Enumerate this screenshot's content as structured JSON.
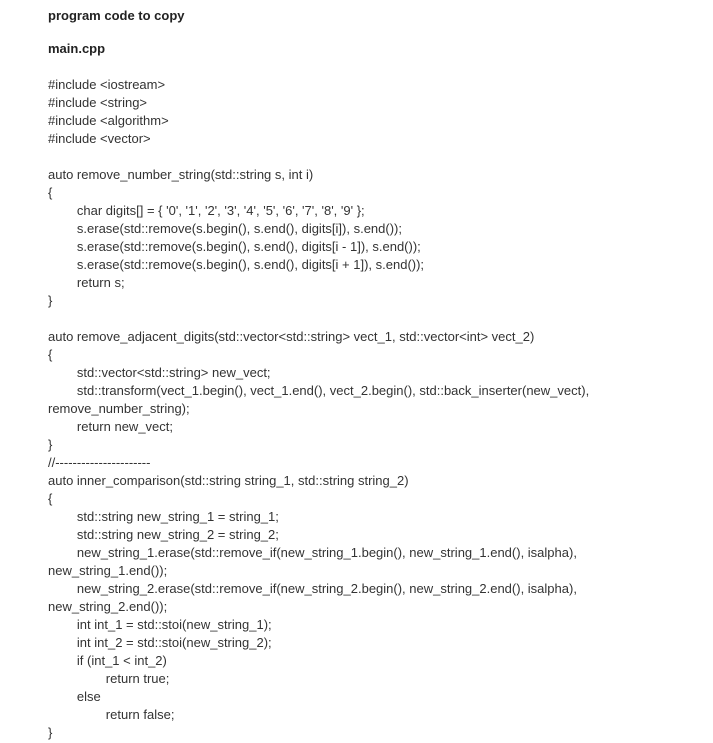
{
  "heading": "program code to copy",
  "filename": "main.cpp",
  "code_lines": [
    "#include <iostream>",
    "#include <string>",
    "#include <algorithm>",
    "#include <vector>",
    "",
    "auto remove_number_string(std::string s, int i)",
    "{",
    "        char digits[] = { '0', '1', '2', '3', '4', '5', '6', '7', '8', '9' };",
    "        s.erase(std::remove(s.begin(), s.end(), digits[i]), s.end());",
    "        s.erase(std::remove(s.begin(), s.end(), digits[i - 1]), s.end());",
    "        s.erase(std::remove(s.begin(), s.end(), digits[i + 1]), s.end());",
    "        return s;",
    "}",
    "",
    "auto remove_adjacent_digits(std::vector<std::string> vect_1, std::vector<int> vect_2)",
    "{",
    "        std::vector<std::string> new_vect;",
    "        std::transform(vect_1.begin(), vect_1.end(), vect_2.begin(), std::back_inserter(new_vect),",
    "remove_number_string);",
    "        return new_vect;",
    "}",
    "//----------------------",
    "auto inner_comparison(std::string string_1, std::string string_2)",
    "{",
    "        std::string new_string_1 = string_1;",
    "        std::string new_string_2 = string_2;",
    "        new_string_1.erase(std::remove_if(new_string_1.begin(), new_string_1.end(), isalpha),",
    "new_string_1.end());",
    "        new_string_2.erase(std::remove_if(new_string_2.begin(), new_string_2.end(), isalpha),",
    "new_string_2.end());",
    "        int int_1 = std::stoi(new_string_1);",
    "        int int_2 = std::stoi(new_string_2);",
    "        if (int_1 < int_2)",
    "                return true;",
    "        else",
    "                return false;",
    "}"
  ]
}
